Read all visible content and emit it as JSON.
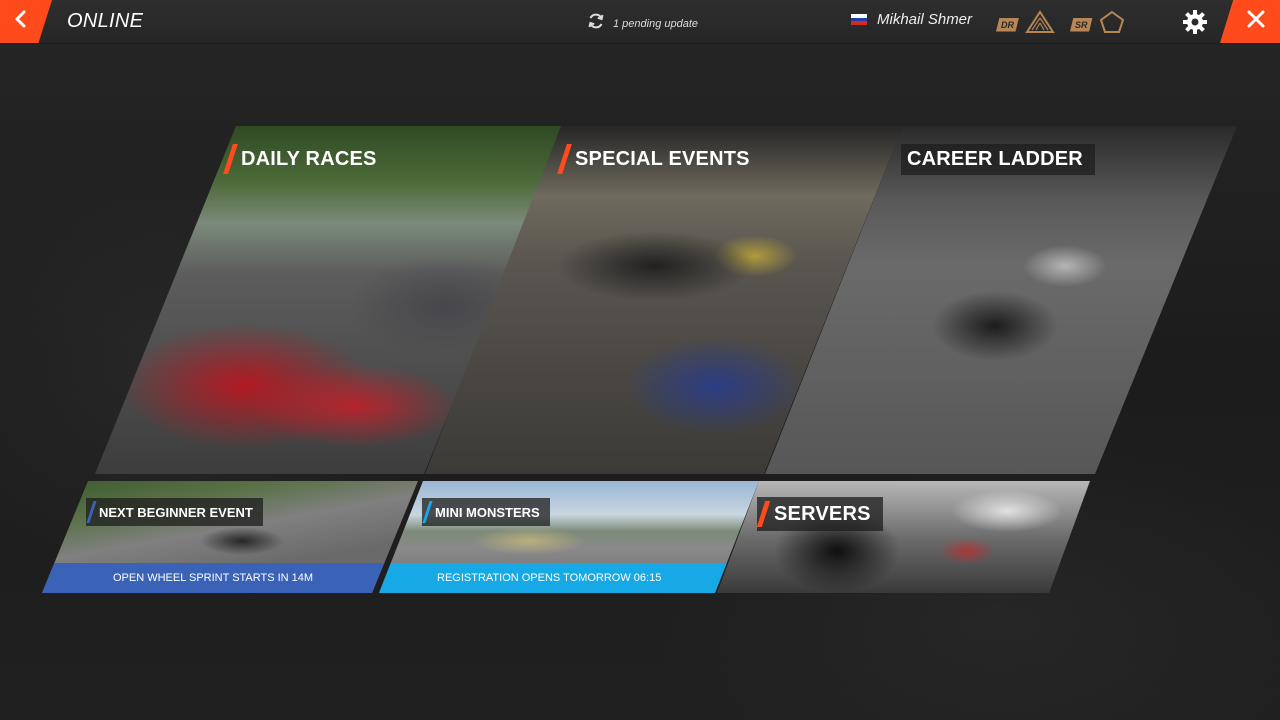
{
  "header": {
    "title": "ONLINE",
    "update_text": "1 pending update",
    "username": "Mikhail Shmer",
    "driver_rating_label": "DR",
    "safety_rating_label": "SR"
  },
  "tiles": {
    "daily_races": "DAILY RACES",
    "special_events": "SPECIAL EVENTS",
    "career_ladder": "CAREER LADDER",
    "next_beginner_event": {
      "title": "NEXT BEGINNER EVENT",
      "status": "OPEN WHEEL SPRINT STARTS IN 14M"
    },
    "mini_monsters": {
      "title": "MINI MONSTERS",
      "status": "REGISTRATION OPENS TOMORROW 06:15"
    },
    "servers": "SERVERS"
  },
  "colors": {
    "accent": "#ff4a1c",
    "beginner_bar": "#3a63b8",
    "mini_bar": "#17a9e6",
    "rating_badge": "#b88654"
  },
  "icons": {
    "back": "chevron-left-icon",
    "close": "close-icon",
    "update": "refresh-icon",
    "flag": "russia-flag-icon",
    "dr": "triangle-rank-icon",
    "sr": "pentagon-rank-icon",
    "settings": "gear-icon"
  }
}
